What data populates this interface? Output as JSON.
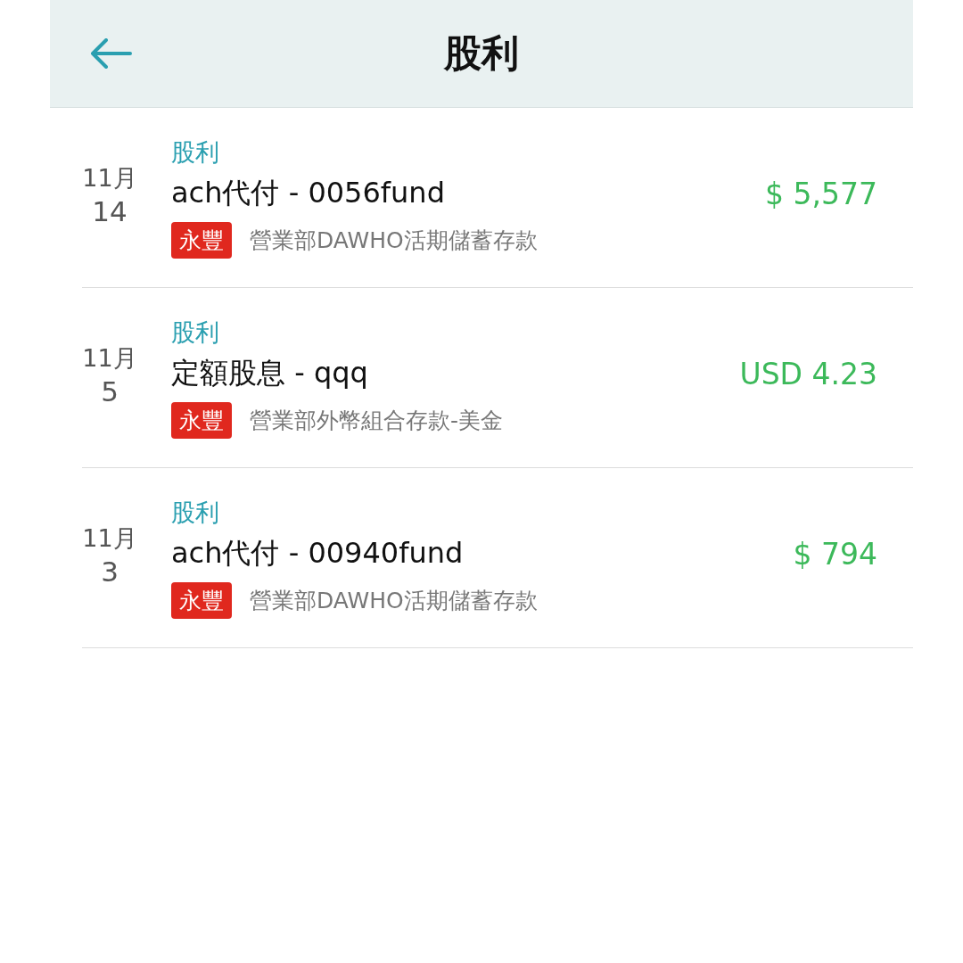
{
  "header": {
    "title": "股利"
  },
  "transactions": [
    {
      "month": "11月",
      "day": "14",
      "category": "股利",
      "title": "ach代付 - 0056fund",
      "bank": "永豐",
      "account": "營業部DAWHO活期儲蓄存款",
      "amount": "$ 5,577"
    },
    {
      "month": "11月",
      "day": "5",
      "category": "股利",
      "title": "定額股息 - qqq",
      "bank": "永豐",
      "account": "營業部外幣組合存款-美金",
      "amount": "USD 4.23"
    },
    {
      "month": "11月",
      "day": "3",
      "category": "股利",
      "title": "ach代付 - 00940fund",
      "bank": "永豐",
      "account": "營業部DAWHO活期儲蓄存款",
      "amount": "$ 794"
    }
  ]
}
